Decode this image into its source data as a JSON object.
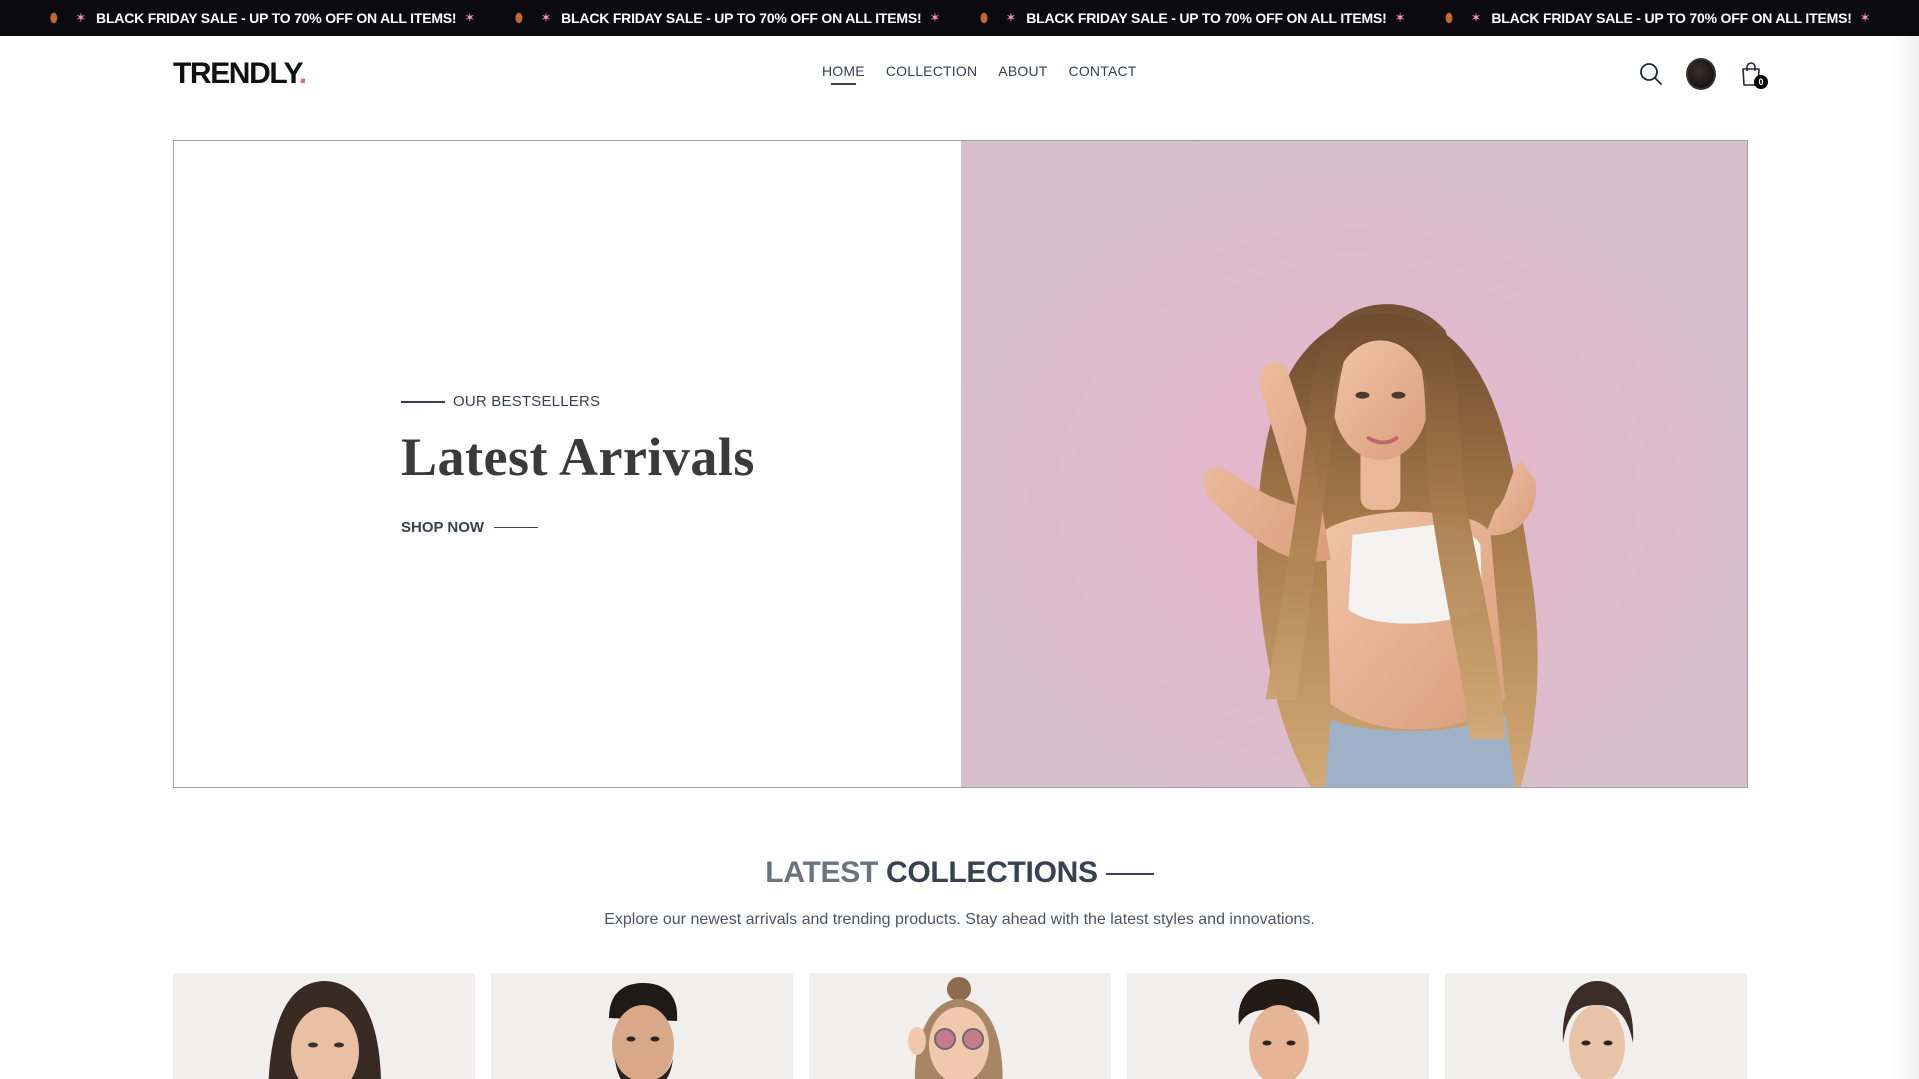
{
  "announcement": {
    "text": "BLACK FRIDAY SALE - UP TO 70% OFF ON ALL ITEMS!",
    "repeat_count": 4,
    "leaf_icon": "leaf-icon",
    "party_icon": "party-popper-icon"
  },
  "header": {
    "logo": "TRENDLY",
    "logo_dot": ".",
    "nav": [
      {
        "label": "HOME",
        "active": true
      },
      {
        "label": "COLLECTION",
        "active": false
      },
      {
        "label": "ABOUT",
        "active": false
      },
      {
        "label": "CONTACT",
        "active": false
      }
    ],
    "cart_count": "0",
    "icons": [
      "search-icon",
      "avatar",
      "shopping-bag-icon"
    ]
  },
  "hero": {
    "eyebrow": "OUR BESTSELLERS",
    "title": "Latest Arrivals",
    "cta": "SHOP NOW"
  },
  "latest_collections": {
    "title_light": "LATEST",
    "title_bold": "COLLECTIONS",
    "subtitle": "Explore our newest arrivals and trending products. Stay ahead with the latest styles and innovations."
  },
  "colors": {
    "announcement_bg": "#0b0b0f",
    "accent_dot": "#e36b8d",
    "hero_image_bg": "#dcbdcc",
    "product_bg": "#eeeeee"
  }
}
